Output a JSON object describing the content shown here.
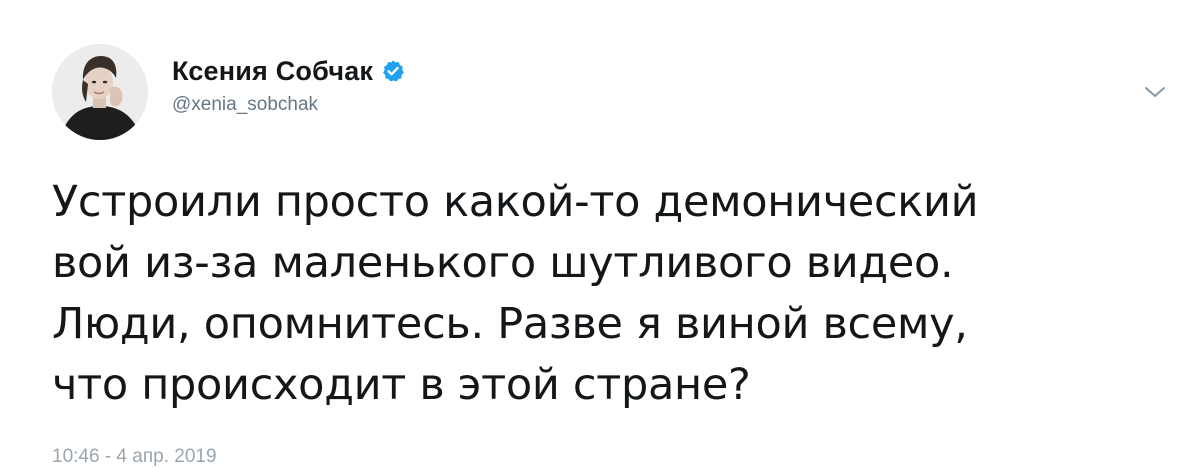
{
  "tweet": {
    "author": {
      "display_name": "Ксения Собчак",
      "handle": "@xenia_sobchak",
      "verified": true
    },
    "text": "Устроили просто какой-то демонический\nвой из-за маленького шутливого видео.\nЛюди, опомнитесь. Разве я виной всему,\nчто происходит в этой стране?",
    "timestamp": "10:46 - 4 апр. 2019"
  },
  "colors": {
    "verified_blue": "#1da1f2",
    "text_primary": "#14171a",
    "text_secondary": "#657786"
  },
  "icons": {
    "verified": "verified-badge-icon",
    "menu": "chevron-down-icon",
    "avatar": "user-avatar"
  }
}
